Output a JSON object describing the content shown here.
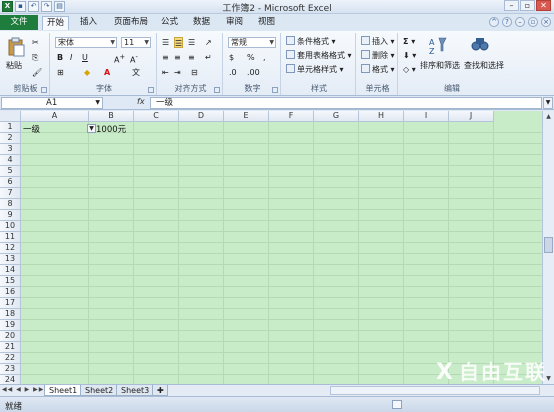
{
  "window": {
    "title": "工作簿2 - Microsoft Excel",
    "qa_icons": [
      "excel-icon",
      "save-icon",
      "undo-icon",
      "redo-icon",
      "print-preview-icon"
    ],
    "controls": [
      "minimize",
      "restore",
      "close"
    ]
  },
  "tabs": {
    "file": "文件",
    "items": [
      "开始",
      "插入",
      "页面布局",
      "公式",
      "数据",
      "审阅",
      "视图"
    ],
    "active": "开始"
  },
  "ribbon": {
    "clipboard": {
      "label": "剪贴板",
      "paste": "粘贴"
    },
    "font": {
      "label": "字体",
      "font_name": "宋体",
      "font_size": "11"
    },
    "alignment": {
      "label": "对齐方式"
    },
    "number": {
      "label": "数字",
      "format": "常规"
    },
    "styles": {
      "label": "样式",
      "conditional": "条件格式",
      "table_format": "套用表格格式",
      "cell_styles": "单元格样式"
    },
    "cells": {
      "label": "单元格",
      "insert": "插入",
      "delete": "删除",
      "format": "格式"
    },
    "editing": {
      "label": "编辑",
      "sort_filter": "排序和筛选",
      "find_select": "查找和选择"
    }
  },
  "formula_bar": {
    "name_box": "A1",
    "fx": "fx",
    "content": "一级"
  },
  "sheet": {
    "columns": [
      "A",
      "B",
      "C",
      "D",
      "E",
      "F",
      "G",
      "H",
      "I",
      "J"
    ],
    "rows": [
      "1",
      "2",
      "3",
      "4",
      "5",
      "6",
      "7",
      "8",
      "9",
      "10",
      "11",
      "12",
      "13",
      "14",
      "15",
      "16",
      "17",
      "18",
      "19",
      "20",
      "21",
      "22",
      "23",
      "24"
    ],
    "cells": {
      "A1": "一级",
      "B1": "1000元"
    },
    "fill_color": "#c8ebc8"
  },
  "sheet_tabs": [
    "Sheet1",
    "Sheet2",
    "Sheet3"
  ],
  "status": {
    "ready": "就绪"
  },
  "watermark": "自由互联"
}
